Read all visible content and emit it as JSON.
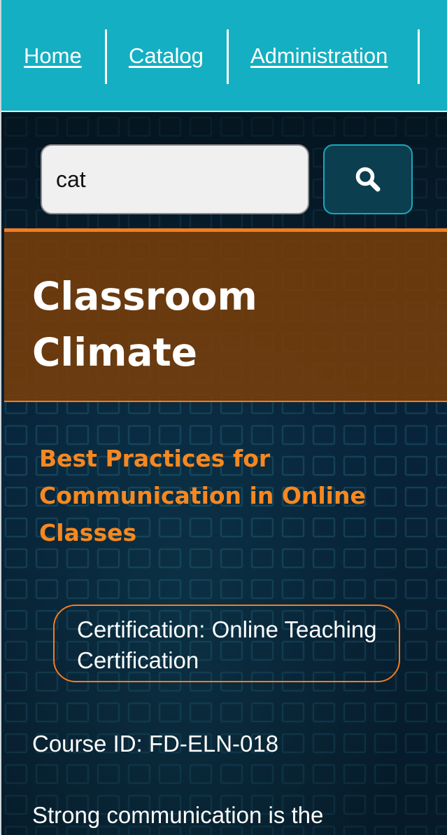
{
  "nav": {
    "home_label": "Home",
    "catalog_label": "Catalog",
    "administration_label": "Administration"
  },
  "search": {
    "value": "cat",
    "icon": "search-icon"
  },
  "banner": {
    "title": "Classroom Climate"
  },
  "course": {
    "title": "Best Practices for Communication in Online Classes",
    "certification": "Certification: Online Teaching Certification",
    "course_id": "Course ID: FD-ELN-018",
    "description": "Strong communication is the"
  },
  "colors": {
    "nav_background": "#14afc2",
    "accent_orange": "#f47c20",
    "title_orange": "#f7881f",
    "banner_brown": "#783e0a",
    "search_button": "#0b3f4f"
  }
}
